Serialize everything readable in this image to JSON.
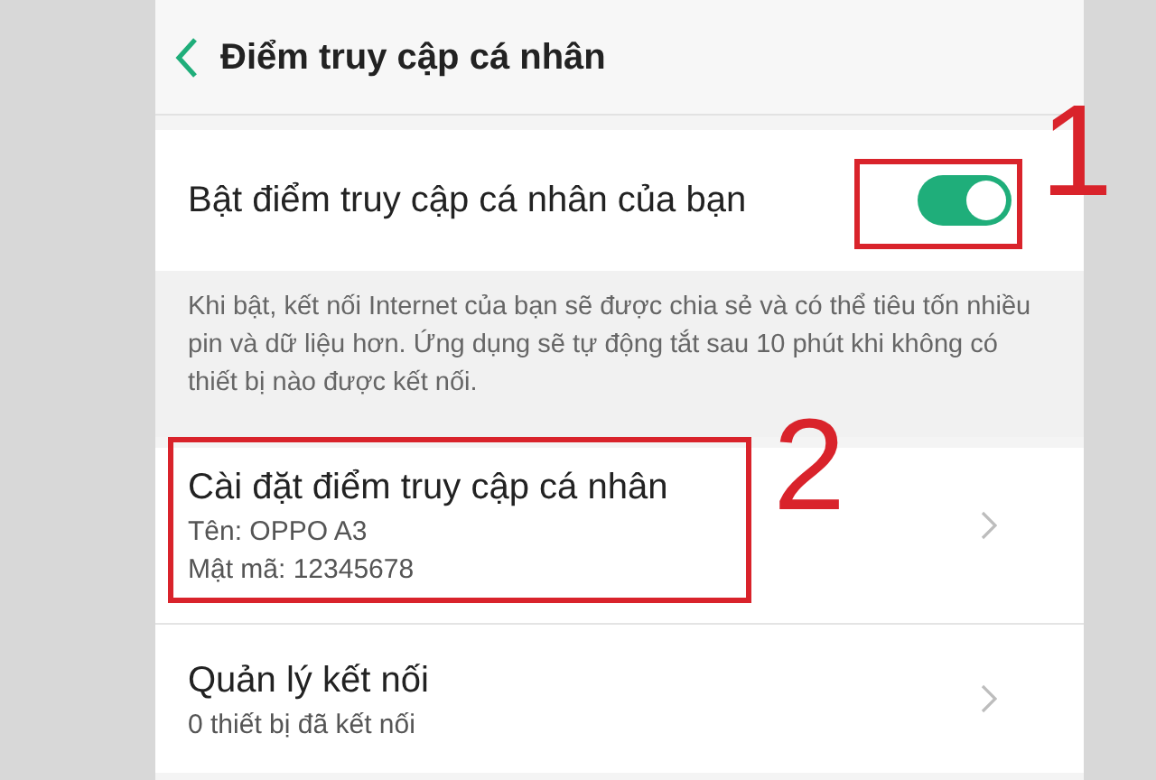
{
  "header": {
    "title": "Điểm truy cập cá nhân"
  },
  "hotspot_toggle": {
    "label": "Bật điểm truy cập cá nhân của bạn",
    "on": true
  },
  "description": "Khi bật, kết nối Internet của bạn sẽ được chia sẻ và có thể tiêu tốn nhiều pin và dữ liệu hơn. Ứng dụng sẽ tự động tắt sau 10 phút khi không có thiết bị nào được kết nối.",
  "rows": [
    {
      "title": "Cài đặt điểm truy cập cá nhân",
      "lines": [
        "Tên: OPPO A3",
        "Mật mã: 12345678"
      ]
    },
    {
      "title": "Quản lý kết nối",
      "lines": [
        "0 thiết bị đã kết nối"
      ]
    }
  ],
  "annotations": [
    {
      "number": "1"
    },
    {
      "number": "2"
    }
  ]
}
